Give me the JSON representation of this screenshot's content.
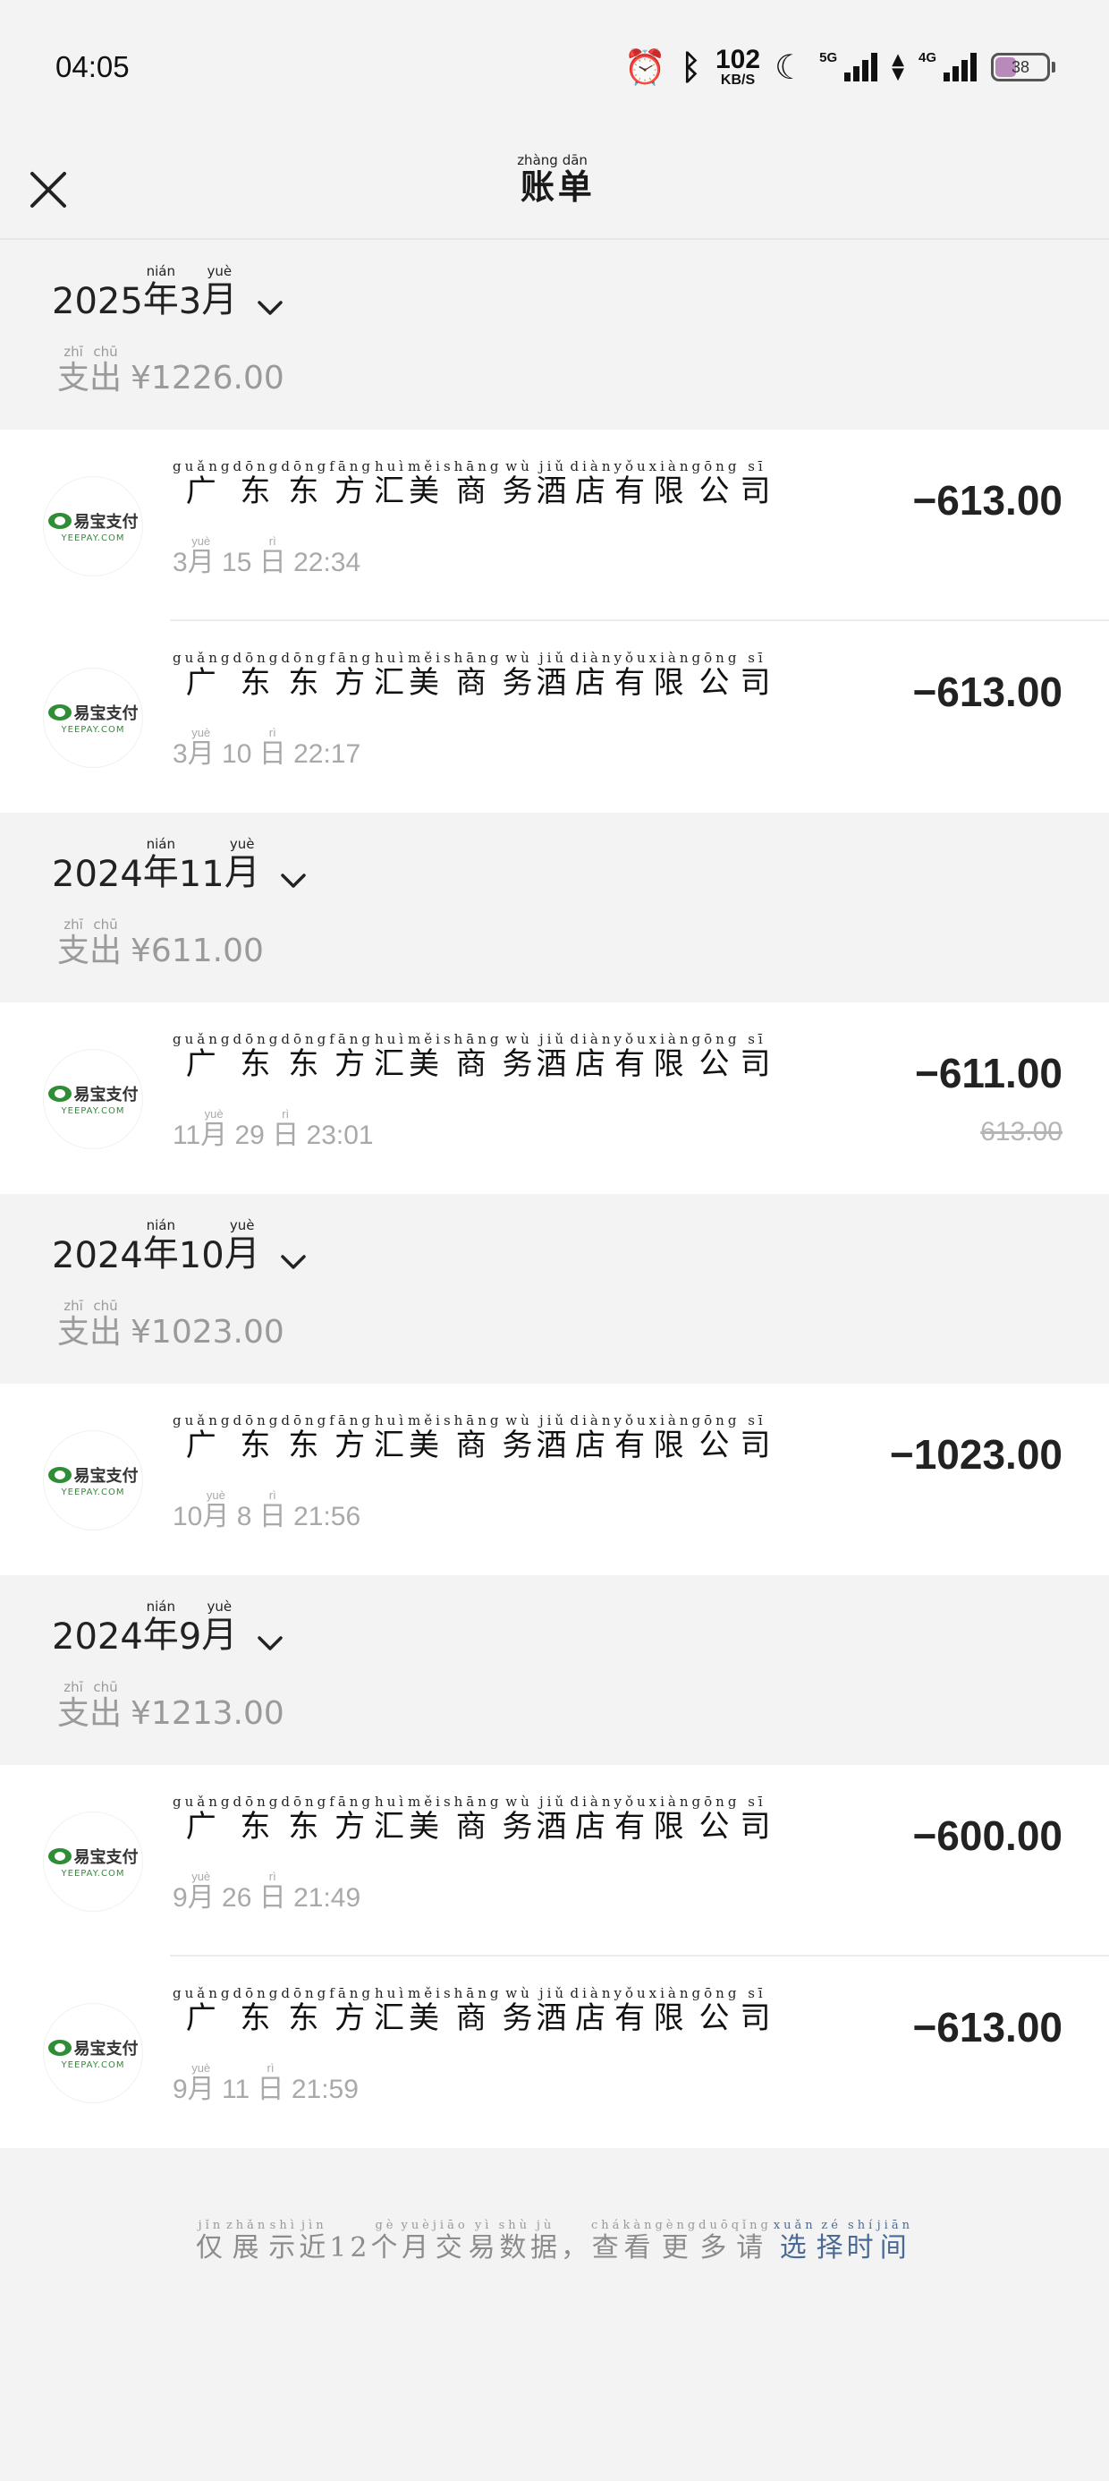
{
  "status": {
    "time": "04:05",
    "speed_value": "102",
    "speed_unit": "KB/S",
    "net1": "5G",
    "net2": "4G",
    "battery": "38",
    "icons": [
      "alarm-icon",
      "bluetooth-icon",
      "moon-icon",
      "signal-icon",
      "data-arrows-icon",
      "battery-icon"
    ]
  },
  "nav": {
    "title": [
      {
        "c": "账",
        "p": "zhàng"
      },
      {
        "c": "单",
        "p": "dān"
      }
    ],
    "close_icon": "close-icon"
  },
  "merchant_name": [
    {
      "c": "广",
      "p": "guǎng"
    },
    {
      "c": "东",
      "p": "dōng"
    },
    {
      "c": "东",
      "p": "dōng"
    },
    {
      "c": "方",
      "p": "fāng"
    },
    {
      "c": "汇",
      "p": "huì"
    },
    {
      "c": "美",
      "p": "měi"
    },
    {
      "c": "商",
      "p": "shāng"
    },
    {
      "c": "务",
      "p": "wù"
    },
    {
      "c": "酒",
      "p": "jiǔ"
    },
    {
      "c": "店",
      "p": "diàn"
    },
    {
      "c": "有",
      "p": "yǒu"
    },
    {
      "c": "限",
      "p": "xiàn"
    },
    {
      "c": "公",
      "p": "gōng"
    },
    {
      "c": "司",
      "p": "sī"
    }
  ],
  "logo": {
    "cn": "易宝支付",
    "en": "YEEPAY.COM"
  },
  "expense_label": [
    {
      "c": "支",
      "p": "zhī"
    },
    {
      "c": "出",
      "p": "chū"
    }
  ],
  "groups": [
    {
      "year": "2025",
      "month": "3",
      "total": "¥1226.00",
      "items": [
        {
          "m": "3",
          "d": "15",
          "clock": "22:34",
          "amount": "−613.00",
          "original": ""
        },
        {
          "m": "3",
          "d": "10",
          "clock": "22:17",
          "amount": "−613.00",
          "original": ""
        }
      ]
    },
    {
      "year": "2024",
      "month": "11",
      "total": "¥611.00",
      "items": [
        {
          "m": "11",
          "d": "29",
          "clock": "23:01",
          "amount": "−611.00",
          "original": "613.00"
        }
      ]
    },
    {
      "year": "2024",
      "month": "10",
      "total": "¥1023.00",
      "items": [
        {
          "m": "10",
          "d": "8",
          "clock": "21:56",
          "amount": "−1023.00",
          "original": ""
        }
      ]
    },
    {
      "year": "2024",
      "month": "9",
      "total": "¥1213.00",
      "items": [
        {
          "m": "9",
          "d": "26",
          "clock": "21:49",
          "amount": "−600.00",
          "original": ""
        },
        {
          "m": "9",
          "d": "11",
          "clock": "21:59",
          "amount": "−613.00",
          "original": ""
        }
      ]
    }
  ],
  "footer": {
    "text": [
      {
        "c": "仅",
        "p": "jǐn"
      },
      {
        "c": "展",
        "p": "zhǎn"
      },
      {
        "c": "示",
        "p": "shì"
      },
      {
        "c": "近",
        "p": "jìn"
      },
      {
        "c": "12",
        "p": ""
      },
      {
        "c": "个",
        "p": "gè"
      },
      {
        "c": "月",
        "p": "yuè"
      },
      {
        "c": "交",
        "p": "jiāo"
      },
      {
        "c": "易",
        "p": "yì"
      },
      {
        "c": "数",
        "p": "shù"
      },
      {
        "c": "据",
        "p": "jù"
      },
      {
        "c": "，",
        "p": ""
      },
      {
        "c": "查",
        "p": "chá"
      },
      {
        "c": "看",
        "p": "kàn"
      },
      {
        "c": "更",
        "p": "gèng"
      },
      {
        "c": "多",
        "p": "duō"
      },
      {
        "c": "请",
        "p": "qǐng"
      }
    ],
    "link": [
      {
        "c": "选",
        "p": "xuǎn"
      },
      {
        "c": "择",
        "p": "zé"
      },
      {
        "c": "时",
        "p": "shí"
      },
      {
        "c": "间",
        "p": "jiān"
      }
    ]
  }
}
